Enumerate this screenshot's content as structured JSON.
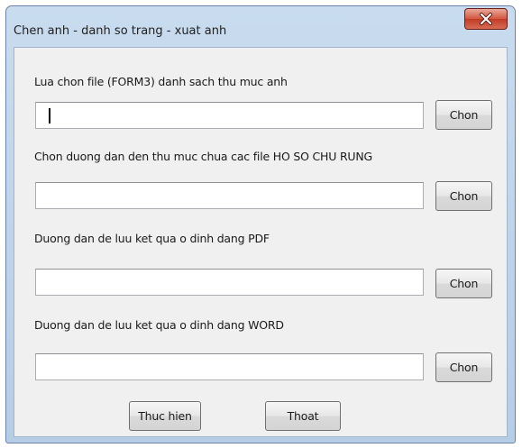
{
  "window": {
    "title": "Chen anh - danh so trang - xuat anh",
    "close_icon": "close-x-icon"
  },
  "sections": [
    {
      "label": "Lua chon file (FORM3) danh sach thu muc anh",
      "value": "",
      "button": "Chon",
      "focused": true
    },
    {
      "label": "Chon duong dan den thu muc chua cac file HO SO CHU RUNG",
      "value": "",
      "button": "Chon",
      "focused": false
    },
    {
      "label": "Duong dan de luu ket qua o dinh dang PDF",
      "value": "",
      "button": "Chon",
      "focused": false
    },
    {
      "label": "Duong dan de luu ket qua o dinh dang WORD",
      "value": "",
      "button": "Chon",
      "focused": false
    }
  ],
  "actions": {
    "run_label": "Thuc hien",
    "exit_label": "Thoat"
  },
  "colors": {
    "frame": "#c9dcef",
    "close_button": "#c13c26",
    "client": "#f0f0f0"
  }
}
